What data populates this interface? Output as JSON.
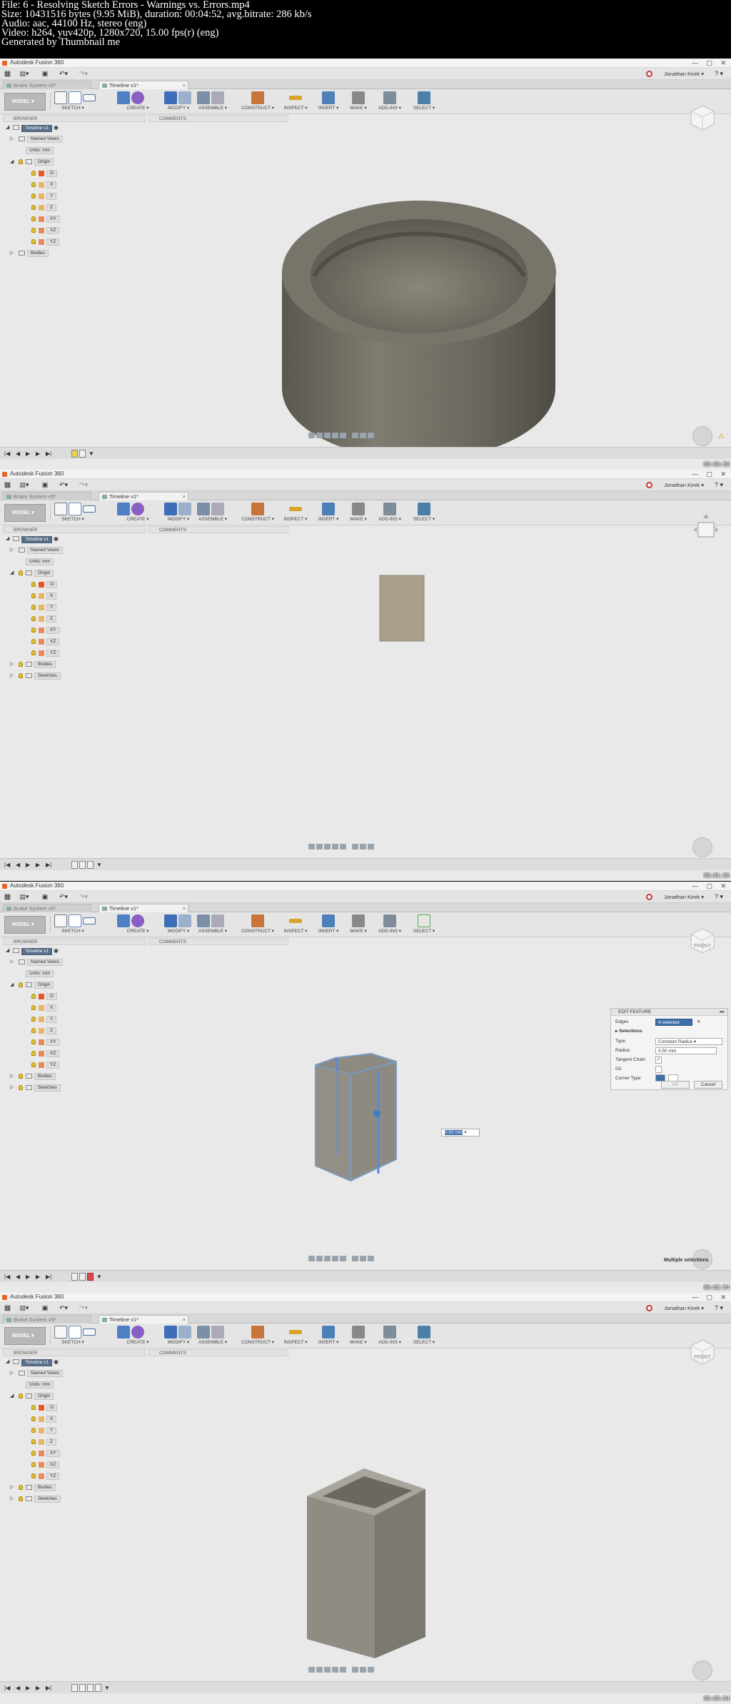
{
  "header": {
    "lines": [
      "File: 6 - Resolving Sketch Errors - Warnings vs. Errors.mp4",
      "Size: 10431516 bytes (9.95 MiB), duration: 00:04:52, avg.bitrate: 286 kb/s",
      "Audio: aac, 44100 Hz, stereo (eng)",
      "Video: h264, yuv420p, 1280x720, 15.00 fps(r) (eng)",
      "Generated by Thumbnail me"
    ]
  },
  "app": {
    "title": "Autodesk Fusion 360",
    "user": "Jonathan Kirek ▾",
    "help": "? ▾",
    "tab_inactive": "Brake System v5*",
    "tab_active": "Timeline v1*",
    "tab_close": "×",
    "win_min": "—",
    "win_max": "▢",
    "win_close": "✕",
    "workspace": "MODEL ▾",
    "groups": [
      "SKETCH ▾",
      "CREATE ▾",
      "MODIFY ▾",
      "ASSEMBLE ▾",
      "CONSTRUCT ▾",
      "INSPECT ▾",
      "INSERT ▾",
      "MAKE ▾",
      "ADD-INS ▾",
      "SELECT ▾"
    ],
    "browser_label": "BROWSER",
    "comments_label": "COMMENTS",
    "accent": "#5a6f8a"
  },
  "tree": {
    "timeline": "Timeline v1",
    "named_views": "Named Views",
    "units": "Units: mm",
    "origin": "Origin",
    "origin_items": [
      "O",
      "X",
      "Y",
      "Z",
      "XY",
      "XZ",
      "YZ"
    ],
    "bodies": "Bodies",
    "sketches": "Sketches"
  },
  "timestamps": [
    "00:00:58",
    "00:01:56",
    "00:02:54",
    "00:03:54"
  ],
  "viewcube": [
    "",
    "",
    "FRONT",
    "FRONT"
  ],
  "dialog": {
    "title": "EDIT FEATURE",
    "edges_label": "Edges",
    "edges_value": "4 selected",
    "edges_clear": "✕",
    "selections": "Selections",
    "type_label": "Type",
    "type_value": "Constant Radius",
    "radius_label": "Radius",
    "radius_value": "0.50 mm",
    "tangent_label": "Tangent Chain",
    "g2_label": "G2",
    "corner_label": "Corner Type",
    "ok": "OK",
    "cancel": "Cancel"
  },
  "radius_tag": "0.50 mm",
  "status_multi": "Multiple selections"
}
